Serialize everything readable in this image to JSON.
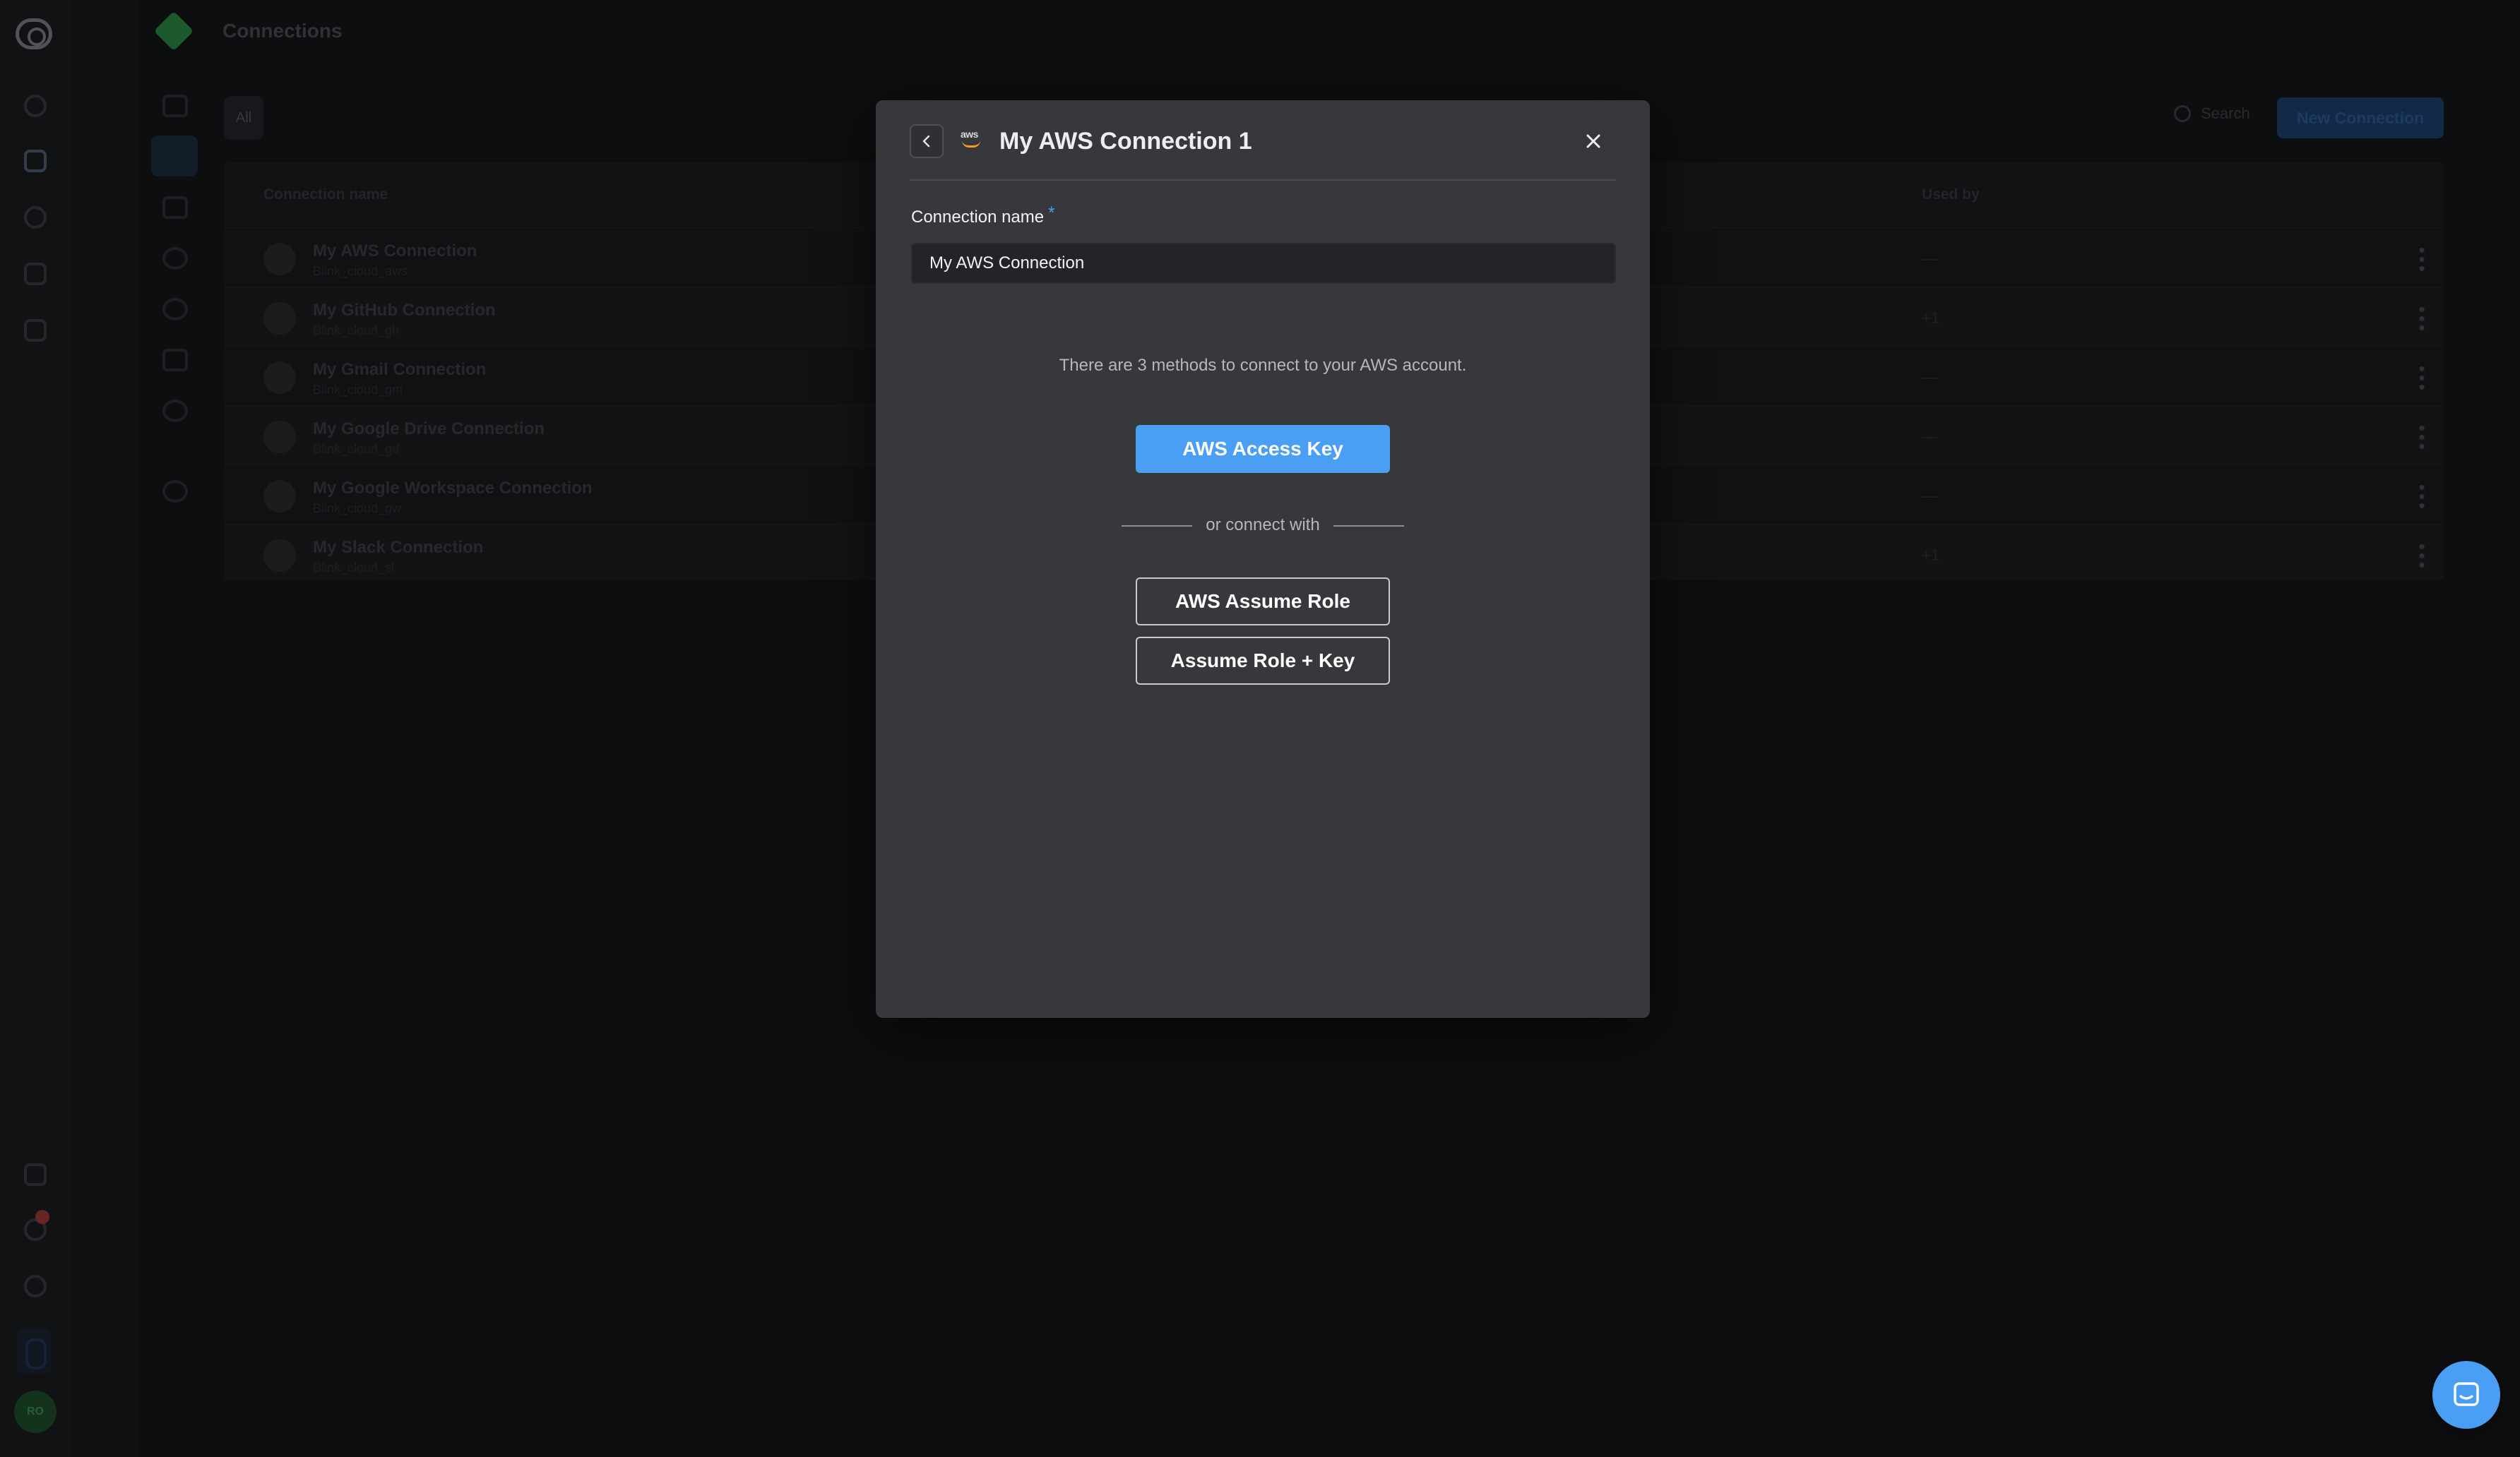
{
  "page": {
    "title": "Connections",
    "filter_all": "All",
    "search_label": "Search",
    "new_connection_label": "New Connection"
  },
  "table": {
    "columns": {
      "name": "Connection name",
      "used_by": "Used by"
    },
    "rows": [
      {
        "name": "My AWS Connection",
        "id": "Blink_cloud_aws",
        "used_by": "—",
        "icon": "aws-icon"
      },
      {
        "name": "My GitHub Connection",
        "id": "Blink_cloud_gh",
        "used_by": "+1",
        "icon": "github-icon"
      },
      {
        "name": "My Gmail Connection",
        "id": "Blink_cloud_gm",
        "used_by": "—",
        "icon": "gmail-icon"
      },
      {
        "name": "My Google Drive Connection",
        "id": "Blink_cloud_gd",
        "used_by": "—",
        "icon": "google-drive-icon"
      },
      {
        "name": "My Google Workspace Connection",
        "id": "Blink_cloud_gw",
        "used_by": "—",
        "icon": "google-icon"
      },
      {
        "name": "My Slack Connection",
        "id": "Blink_cloud_sl",
        "used_by": "+1",
        "icon": "slack-icon"
      }
    ]
  },
  "modal": {
    "title": "My AWS Connection 1",
    "provider_logo_text": "aws",
    "field_label": "Connection name",
    "required_mark": "*",
    "field_value": "My AWS Connection",
    "info_text": "There are 3 methods to connect to your AWS account.",
    "primary_button": "AWS Access Key",
    "divider_text": "or connect with",
    "secondary_buttons": [
      "AWS Assume Role",
      "Assume Role + Key"
    ]
  },
  "user": {
    "initials": "RO"
  },
  "colors": {
    "accent": "#4a9ef3",
    "modal_bg": "#37383c",
    "page_bg": "#151618",
    "aws_orange": "#f39c25"
  }
}
